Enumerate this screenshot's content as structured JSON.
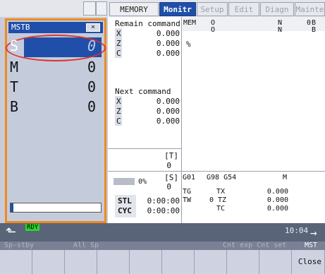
{
  "tabs": [
    {
      "label": "MEMORY",
      "state": "normal"
    },
    {
      "label": "Monitr",
      "state": "active"
    },
    {
      "label": "Setup",
      "state": "dim"
    },
    {
      "label": "Edit",
      "state": "dim"
    },
    {
      "label": "Diagn",
      "state": "dim"
    },
    {
      "label": "Mainte",
      "state": "dim"
    }
  ],
  "mstb": {
    "title": "MSTB",
    "close": "×",
    "rows": [
      {
        "letter": "S",
        "value": "0"
      },
      {
        "letter": "M",
        "value": "0"
      },
      {
        "letter": "T",
        "value": "0"
      },
      {
        "letter": "B",
        "value": "0"
      }
    ]
  },
  "remain": {
    "title": "Remain command",
    "axes": [
      {
        "name": "X",
        "value": "0.000"
      },
      {
        "name": "Z",
        "value": "0.000"
      },
      {
        "name": "C",
        "value": "0.000"
      }
    ]
  },
  "next": {
    "title": "Next command",
    "axes": [
      {
        "name": "X",
        "value": "0.000"
      },
      {
        "name": "Z",
        "value": "0.000"
      },
      {
        "name": "C",
        "value": "0.000"
      }
    ]
  },
  "program": {
    "mem": "MEM",
    "o1": "O",
    "n1": "N",
    "b1": "0",
    "b1l": "B",
    "o2": "O",
    "n2": "N",
    "b2": "B",
    "pct": "%"
  },
  "status": {
    "t_label": "[T]",
    "t_val": "0",
    "s_label": "[S]",
    "s_val": "0",
    "pct": "0%",
    "stl": "STL",
    "stl_time": "0:00:00",
    "cyc": "CYC",
    "cyc_time": "0:00:00"
  },
  "gcodes": {
    "g1": "G01",
    "g2": "G98 G54",
    "m": "M",
    "tg": "TG",
    "tx": "TX",
    "tx_val": "0.000",
    "tw": "TW",
    "tz": "0 TZ",
    "tz_val": "0.000",
    "tc": "TC",
    "tc_val": "0.000"
  },
  "bottom": {
    "rdy": "RDY",
    "time": "10:04"
  },
  "softkeys": {
    "sp_stby": "Sp-stby",
    "all_sp": "All Sp",
    "cnt_exp": "Cnt exp Cnt set",
    "mst": "MST",
    "close": "Close"
  },
  "colors": {
    "accent": "#1f4fa8",
    "highlight": "#f08a1e",
    "callout": "#e03030"
  }
}
